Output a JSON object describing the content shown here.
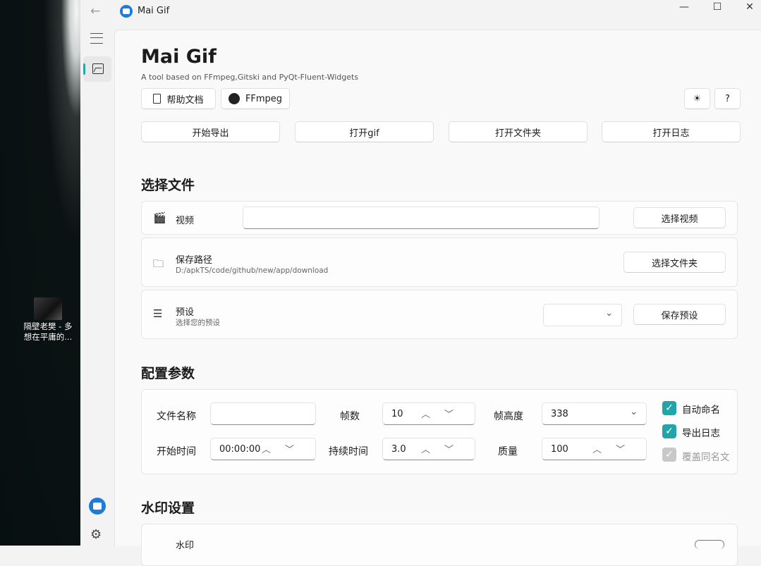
{
  "desktop": {
    "shortcut_label": "隔壁老樊 - 多\n想在平庸的..."
  },
  "window": {
    "title": "Mai Gif",
    "controls": {
      "minimize": "—",
      "maximize": "☐",
      "close": "✕"
    }
  },
  "header": {
    "title": "Mai Gif",
    "subtitle": "A tool based on FFmpeg,Gitski and PyQt-Fluent-Widgets",
    "help_label": "帮助文档",
    "ffmpeg_label": "FFmpeg",
    "theme_icon": "☀",
    "about_icon": "?"
  },
  "actions": [
    {
      "label": "开始导出"
    },
    {
      "label": "打开gif"
    },
    {
      "label": "打开文件夹"
    },
    {
      "label": "打开日志"
    }
  ],
  "select_files": {
    "section_title": "选择文件",
    "video": {
      "label": "视频",
      "value": "",
      "button": "选择视频"
    },
    "save_path": {
      "label": "保存路径",
      "value": "D:/apkTS/code/github/new/app/download",
      "button": "选择文件夹"
    },
    "preset": {
      "label": "预设",
      "sub": "选择您的预设",
      "value": "",
      "button": "保存预设"
    }
  },
  "config": {
    "section_title": "配置参数",
    "file_name": {
      "label": "文件名称",
      "value": ""
    },
    "fps": {
      "label": "帧数",
      "value": "10"
    },
    "frame_height": {
      "label": "帧高度",
      "value": "338"
    },
    "start_time": {
      "label": "开始时间",
      "value": "00:00:00"
    },
    "duration": {
      "label": "持续时间",
      "value": "3.0"
    },
    "quality": {
      "label": "质量",
      "value": "100"
    },
    "checks": [
      {
        "label": "自动命名",
        "checked": true,
        "disabled": false
      },
      {
        "label": "导出日志",
        "checked": true,
        "disabled": false
      },
      {
        "label": "覆盖同名文",
        "checked": true,
        "disabled": true
      }
    ]
  },
  "watermark": {
    "section_title": "水印设置",
    "label": "水印"
  },
  "colors": {
    "accent": "#22a4a8",
    "brand": "#1f7bd6"
  }
}
